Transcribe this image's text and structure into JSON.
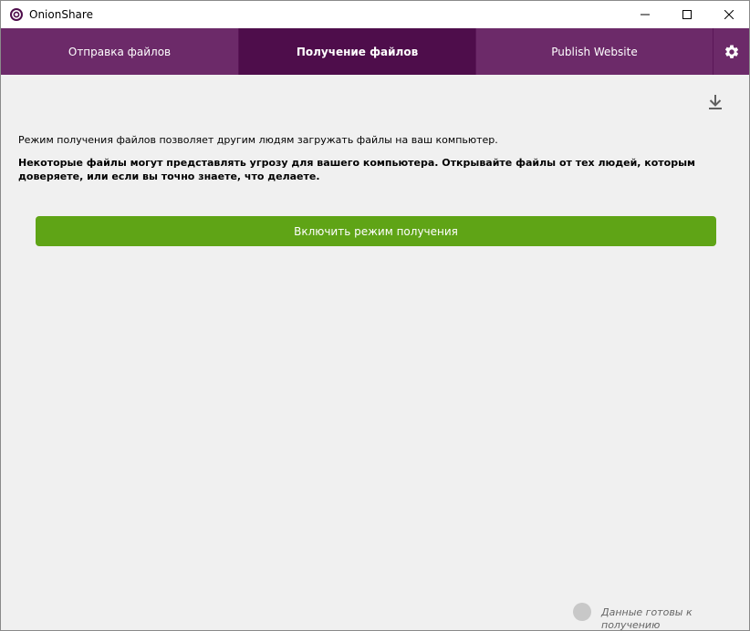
{
  "window": {
    "title": "OnionShare"
  },
  "tabs": [
    {
      "label": "Отправка файлов",
      "active": false
    },
    {
      "label": "Получение файлов",
      "active": true
    },
    {
      "label": "Publish Website",
      "active": false
    }
  ],
  "icons": {
    "app": "onionshare-logo-icon",
    "settings": "gear-icon",
    "download": "download-icon",
    "minimize": "minimize-icon",
    "maximize": "maximize-icon",
    "close": "close-icon"
  },
  "main": {
    "info_text": "Режим получения файлов позволяет другим людям загружать файлы на ваш компьютер.",
    "warning_text": "Некоторые файлы могут представлять угрозу для вашего компьютера. Открывайте файлы от тех людей, которым доверяете, или если вы точно знаете, что делаете.",
    "start_button_label": "Включить режим получения"
  },
  "status": {
    "text": "Данные готовы к получению"
  },
  "colors": {
    "tab_bar": "#6c2a69",
    "tab_active": "#4e0d4b",
    "start_button": "#5fa416",
    "status_indicator": "#c8c8c8"
  }
}
